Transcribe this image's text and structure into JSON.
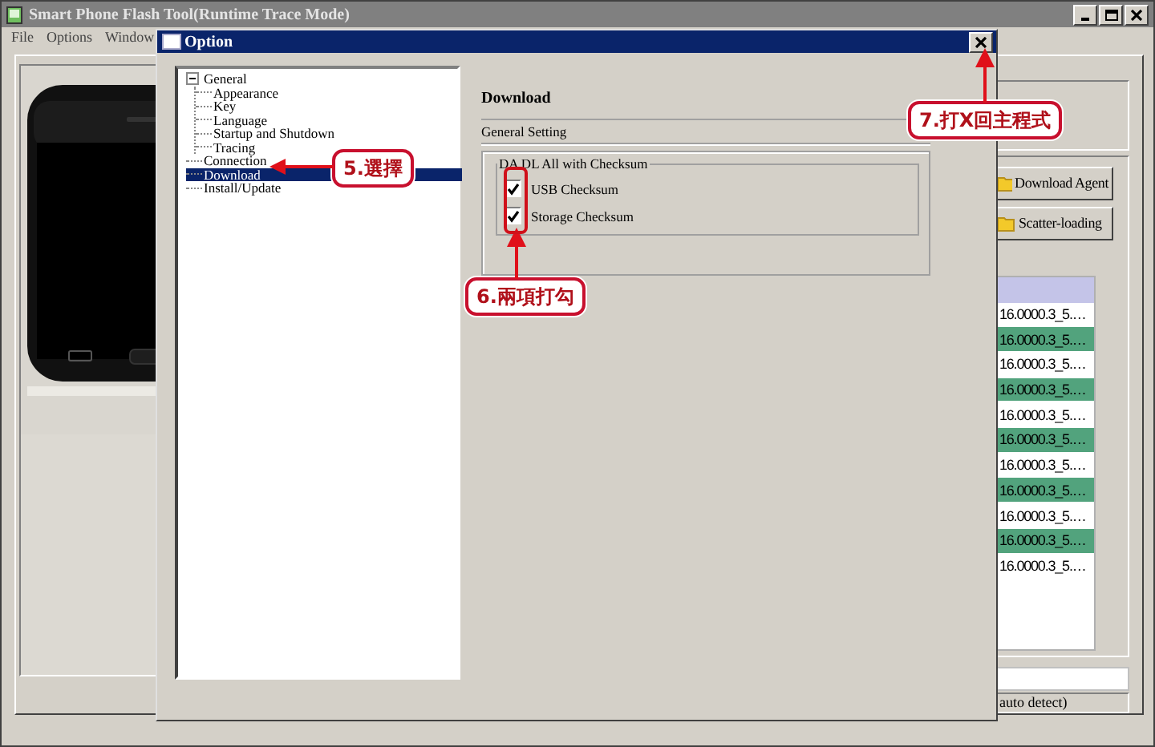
{
  "main_window": {
    "title": "Smart Phone Flash Tool(Runtime Trace Mode)",
    "menu": [
      "File",
      "Options",
      "Window"
    ],
    "buttons": [
      "Download Agent",
      "Scatter-loading"
    ],
    "table": {
      "rows": [
        {
          "column_1": "16.0000.3_5.…",
          "shaded": false
        },
        {
          "column_1": "16.0000.3_5.…",
          "shaded": true
        },
        {
          "column_1": "16.0000.3_5.…",
          "shaded": false
        },
        {
          "column_1": "16.0000.3_5.…",
          "shaded": true
        },
        {
          "column_1": "16.0000.3_5.…",
          "shaded": false
        },
        {
          "column_1": "16.0000.3_5.…",
          "shaded": true
        },
        {
          "column_1": "16.0000.3_5.…",
          "shaded": false
        },
        {
          "column_1": "16.0000.3_5.…",
          "shaded": true
        },
        {
          "column_1": "16.0000.3_5.…",
          "shaded": false
        },
        {
          "column_1": "16.0000.3_5.…",
          "shaded": true
        },
        {
          "column_1": "16.0000.3_5.…",
          "shaded": false
        }
      ]
    },
    "status_text": "auto detect)"
  },
  "dialog": {
    "title": "Option",
    "tree": [
      {
        "label": "General",
        "selected": false,
        "expanded": true,
        "children": [
          {
            "label": "Appearance",
            "selected": false
          },
          {
            "label": "Key",
            "selected": false
          },
          {
            "label": "Language",
            "selected": false
          },
          {
            "label": "Startup and Shutdown",
            "selected": false
          },
          {
            "label": "Tracing",
            "selected": false
          }
        ]
      },
      {
        "label": "Connection",
        "selected": false
      },
      {
        "label": "Download",
        "selected": true
      },
      {
        "label": "Install/Update",
        "selected": false
      }
    ],
    "page_title": "Download",
    "section": "General Setting",
    "group": {
      "title": "DA DL All with Checksum",
      "options": [
        {
          "label": "USB Checksum",
          "checked": true
        },
        {
          "label": "Storage Checksum",
          "checked": true
        }
      ]
    }
  },
  "annotations": [
    {
      "text": "5.選擇",
      "kind": "arrow-left"
    },
    {
      "text": "6.兩項打勾",
      "kind": "framed-arrow-up"
    },
    {
      "text": "7.打X回主程式",
      "kind": "arrow-up"
    }
  ]
}
